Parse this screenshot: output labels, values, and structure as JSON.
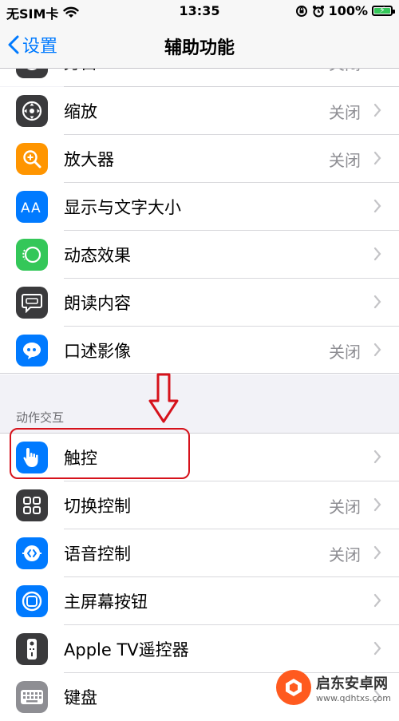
{
  "status_bar": {
    "carrier": "无SIM卡",
    "time": "13:35",
    "battery": "100%",
    "battery_level": 1.0
  },
  "nav": {
    "back_label": "设置",
    "title": "辅助功能"
  },
  "top_partial": {
    "label": "旁白",
    "value": "关闭"
  },
  "vision_items": [
    {
      "label": "缩放",
      "value": "关闭",
      "icon": "zoom-icon",
      "color": "#3a3a3c"
    },
    {
      "label": "放大器",
      "value": "关闭",
      "icon": "magnifier-icon",
      "color": "#ff9500"
    },
    {
      "label": "显示与文字大小",
      "value": "",
      "icon": "text-size-icon",
      "color": "#007aff"
    },
    {
      "label": "动态效果",
      "value": "",
      "icon": "motion-icon",
      "color": "#34c759"
    },
    {
      "label": "朗读内容",
      "value": "",
      "icon": "speech-bubble-icon",
      "color": "#3a3a3c"
    },
    {
      "label": "口述影像",
      "value": "关闭",
      "icon": "audio-description-icon",
      "color": "#007aff"
    }
  ],
  "interaction_section": {
    "header": "动作交互",
    "items": [
      {
        "label": "触控",
        "value": "",
        "icon": "touch-hand-icon",
        "color": "#007aff"
      },
      {
        "label": "切换控制",
        "value": "关闭",
        "icon": "switch-grid-icon",
        "color": "#3a3a3c"
      },
      {
        "label": "语音控制",
        "value": "关闭",
        "icon": "voice-control-icon",
        "color": "#007aff"
      },
      {
        "label": "主屏幕按钮",
        "value": "",
        "icon": "home-button-icon",
        "color": "#007aff"
      },
      {
        "label": "Apple TV遥控器",
        "value": "",
        "icon": "remote-icon",
        "color": "#3a3a3c"
      },
      {
        "label": "键盘",
        "value": "",
        "icon": "keyboard-icon",
        "color": "#8e8e93"
      }
    ]
  },
  "watermark": {
    "name": "启东安卓网",
    "url": "www.qdhtxs.com"
  }
}
